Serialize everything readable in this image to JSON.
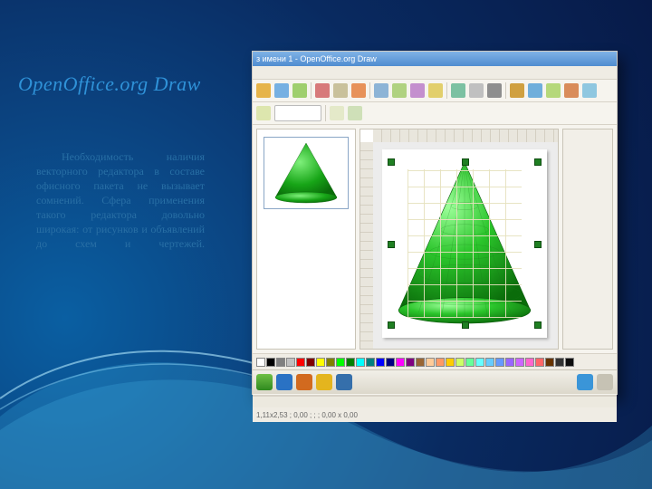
{
  "slide": {
    "title": "OpenOffice.org Draw",
    "paragraph": "Необходимость наличия векторного редактора в составе офисного пакета не вызывает сомнений. Сфера применения такого редактора довольно широкая: от рисунков и объявлений до схем и чертежей."
  },
  "screenshot": {
    "window_title": "з имени 1 - OpenOffice.org Draw",
    "statusbar": "1,11x2,53 ; 0,00 ;   ;   ; 0,00 x 0,00",
    "toolbar_icons": [
      "new-doc-icon",
      "open-icon",
      "save-icon",
      "email-icon",
      "pdf-icon",
      "print-icon",
      "spellcheck-icon",
      "cut-icon",
      "copy-icon",
      "paste-icon",
      "format-paintbrush-icon",
      "undo-icon",
      "redo-icon",
      "chart-icon",
      "hyperlink-icon",
      "navigator-icon",
      "zoom-icon",
      "help-icon"
    ],
    "shape_icons": [
      "select-icon",
      "line-icon",
      "arrow-icon",
      "rectangle-icon",
      "ellipse-icon",
      "text-icon",
      "curve-icon",
      "connector-icon",
      "basic-shapes-icon",
      "symbol-shapes-icon",
      "block-arrows-icon",
      "flowchart-icon",
      "callouts-icon",
      "stars-icon",
      "3d-objects-icon",
      "align-icon",
      "arrange-icon",
      "fontwork-icon",
      "from-file-icon",
      "gallery-icon",
      "effects-icon"
    ],
    "color_swatches": [
      "#ffffff",
      "#000000",
      "#808080",
      "#c0c0c0",
      "#ff0000",
      "#800000",
      "#ffff00",
      "#808000",
      "#00ff00",
      "#008000",
      "#00ffff",
      "#008080",
      "#0000ff",
      "#000080",
      "#ff00ff",
      "#800080",
      "#996633",
      "#ffcc99",
      "#ff9966",
      "#ffcc00",
      "#ccff66",
      "#66ff99",
      "#66ffff",
      "#66ccff",
      "#6699ff",
      "#9966ff",
      "#cc66ff",
      "#ff66cc",
      "#ff6666",
      "#663300",
      "#333333",
      "#0d0d0d"
    ]
  }
}
